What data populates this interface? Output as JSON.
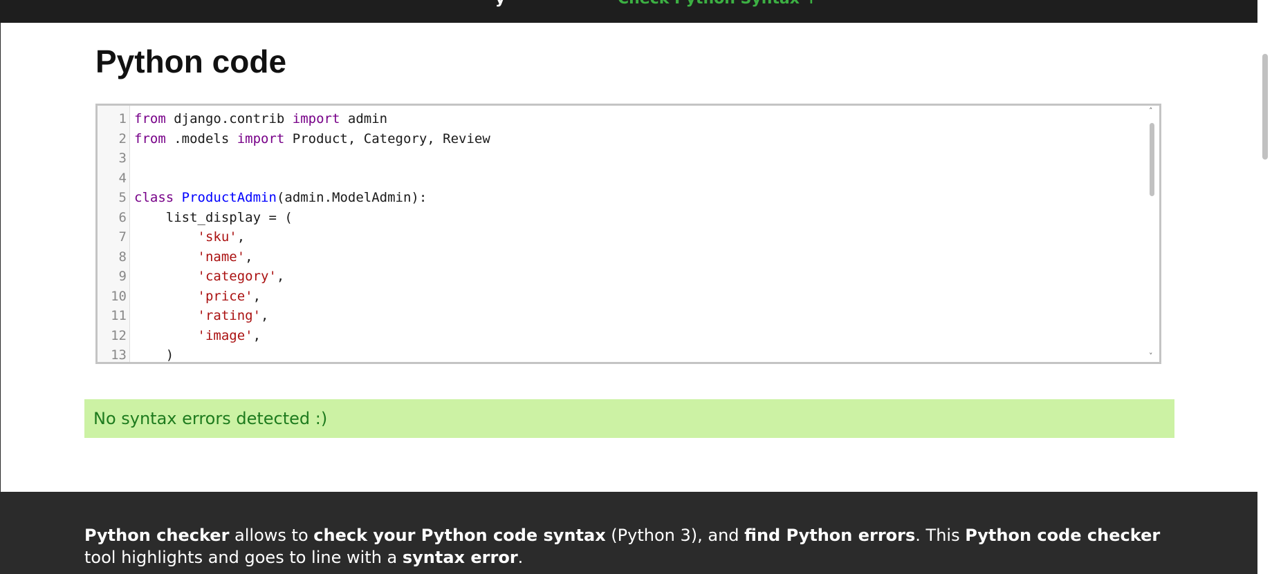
{
  "top_bar": {
    "cut_text": "y",
    "link_text": "Check Python Syntax ↑"
  },
  "main": {
    "title": "Python code"
  },
  "editor": {
    "lines": [
      {
        "num": "1",
        "tokens": [
          {
            "t": "kw",
            "v": "from"
          },
          {
            "t": "plain",
            "v": " django.contrib "
          },
          {
            "t": "kw",
            "v": "import"
          },
          {
            "t": "plain",
            "v": " admin"
          }
        ]
      },
      {
        "num": "2",
        "tokens": [
          {
            "t": "kw",
            "v": "from"
          },
          {
            "t": "plain",
            "v": " .models "
          },
          {
            "t": "kw",
            "v": "import"
          },
          {
            "t": "plain",
            "v": " Product, Category, Review"
          }
        ]
      },
      {
        "num": "3",
        "tokens": []
      },
      {
        "num": "4",
        "tokens": []
      },
      {
        "num": "5",
        "tokens": [
          {
            "t": "kw",
            "v": "class"
          },
          {
            "t": "plain",
            "v": " "
          },
          {
            "t": "def",
            "v": "ProductAdmin"
          },
          {
            "t": "plain",
            "v": "(admin.ModelAdmin):"
          }
        ]
      },
      {
        "num": "6",
        "tokens": [
          {
            "t": "plain",
            "v": "    list_display = ("
          }
        ]
      },
      {
        "num": "7",
        "tokens": [
          {
            "t": "plain",
            "v": "        "
          },
          {
            "t": "str",
            "v": "'sku'"
          },
          {
            "t": "plain",
            "v": ","
          }
        ]
      },
      {
        "num": "8",
        "tokens": [
          {
            "t": "plain",
            "v": "        "
          },
          {
            "t": "str",
            "v": "'name'"
          },
          {
            "t": "plain",
            "v": ","
          }
        ]
      },
      {
        "num": "9",
        "tokens": [
          {
            "t": "plain",
            "v": "        "
          },
          {
            "t": "str",
            "v": "'category'"
          },
          {
            "t": "plain",
            "v": ","
          }
        ]
      },
      {
        "num": "10",
        "tokens": [
          {
            "t": "plain",
            "v": "        "
          },
          {
            "t": "str",
            "v": "'price'"
          },
          {
            "t": "plain",
            "v": ","
          }
        ]
      },
      {
        "num": "11",
        "tokens": [
          {
            "t": "plain",
            "v": "        "
          },
          {
            "t": "str",
            "v": "'rating'"
          },
          {
            "t": "plain",
            "v": ","
          }
        ]
      },
      {
        "num": "12",
        "tokens": [
          {
            "t": "plain",
            "v": "        "
          },
          {
            "t": "str",
            "v": "'image'"
          },
          {
            "t": "plain",
            "v": ","
          }
        ]
      },
      {
        "num": "13",
        "tokens": [
          {
            "t": "plain",
            "v": "    )"
          }
        ]
      }
    ],
    "scroll_up_icon": "˄",
    "scroll_down_icon": "˅"
  },
  "result": {
    "message": "No syntax errors detected :)"
  },
  "footer": {
    "segments": [
      {
        "b": true,
        "v": "Python checker"
      },
      {
        "b": false,
        "v": " allows to "
      },
      {
        "b": true,
        "v": "check your Python code syntax"
      },
      {
        "b": false,
        "v": " (Python 3), and "
      },
      {
        "b": true,
        "v": "find Python errors"
      },
      {
        "b": false,
        "v": ". This "
      },
      {
        "b": true,
        "v": "Python code checker"
      },
      {
        "b": false,
        "v": " tool highlights and goes to line with a "
      },
      {
        "b": true,
        "v": "syntax error"
      },
      {
        "b": false,
        "v": "."
      }
    ]
  },
  "colors": {
    "keyword": "#770088",
    "definition": "#0000ff",
    "string": "#aa1111",
    "success_bg": "#ccf2a4",
    "success_text": "#1e7b1e",
    "link_green": "#3cb043"
  }
}
